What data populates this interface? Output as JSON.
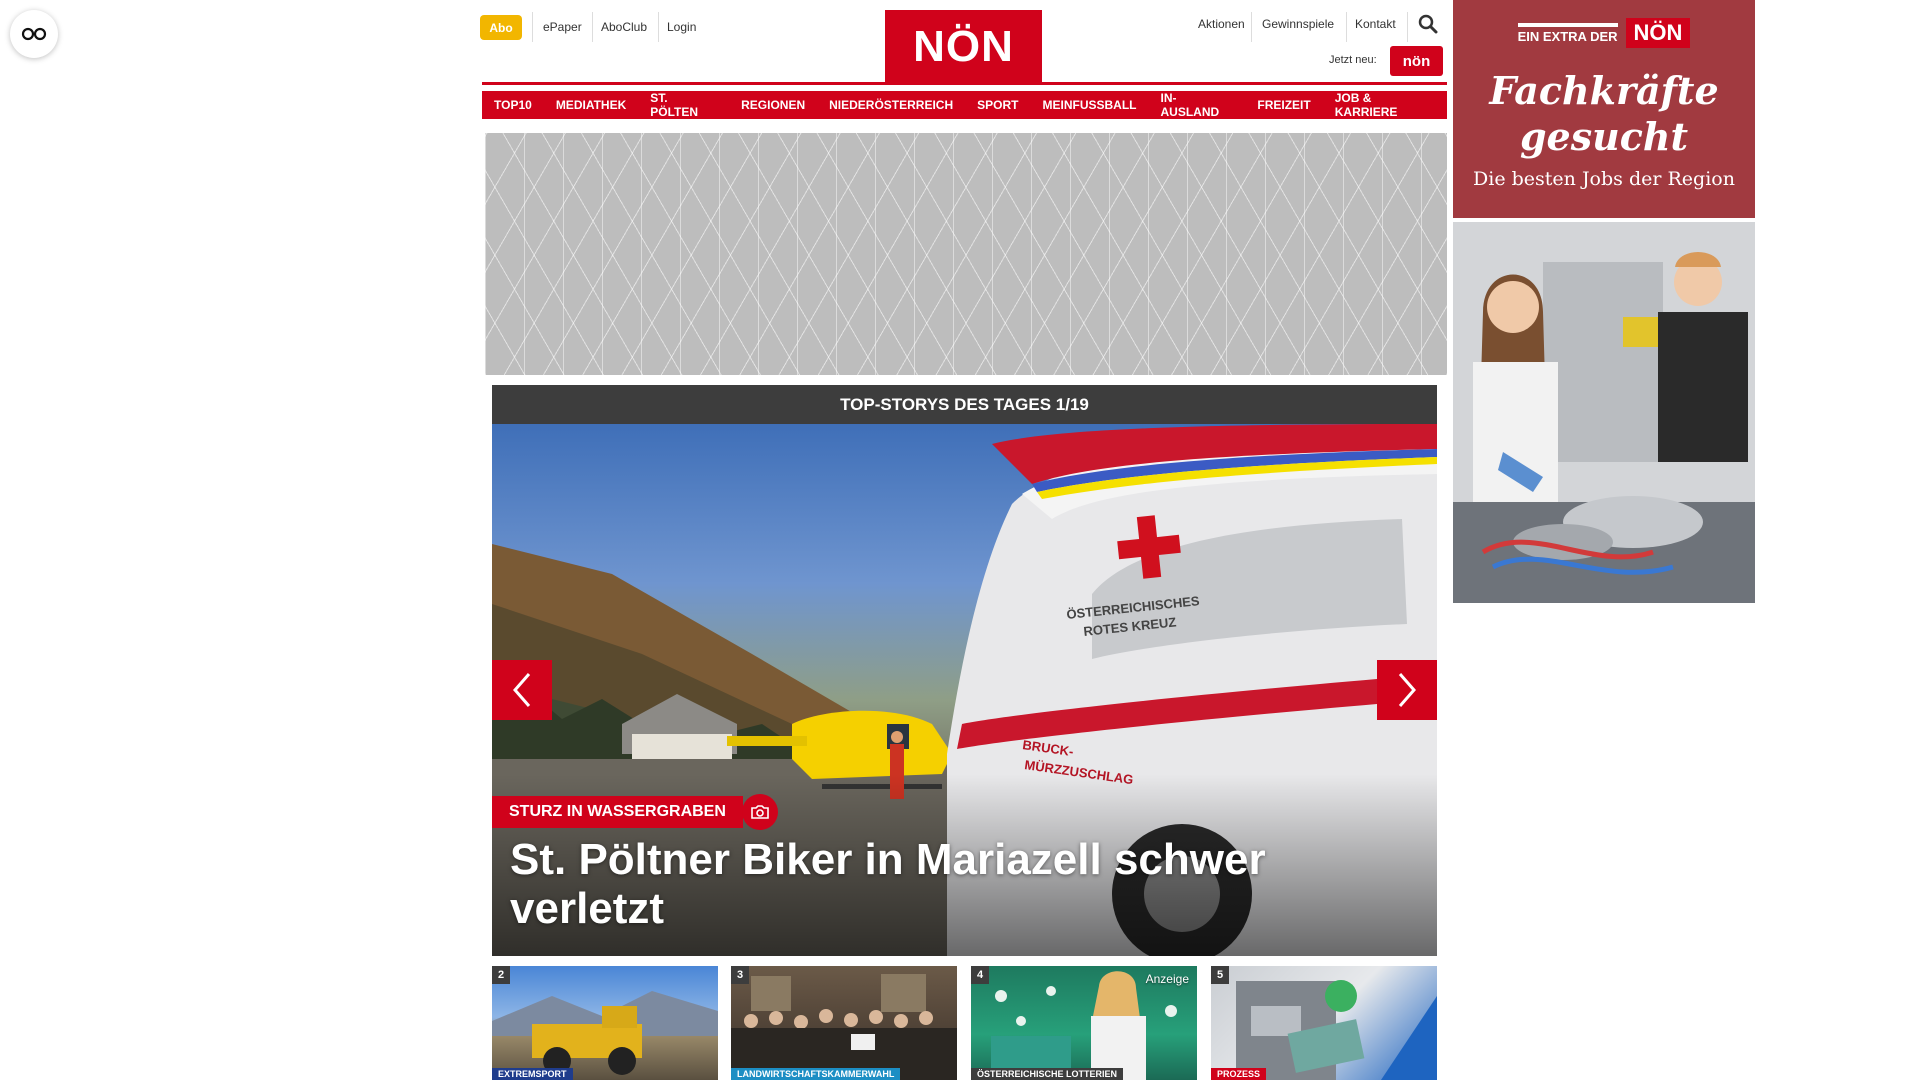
{
  "accessibility": {
    "icon": "glasses-icon"
  },
  "utility_nav": {
    "abo": "Abo",
    "links": [
      "ePaper",
      "AboClub",
      "Login"
    ]
  },
  "top_right_nav": {
    "links": [
      "Aktionen",
      "Gewinnspiele",
      "Kontakt"
    ],
    "search_icon": "search-icon",
    "jetzt_neu": "Jetzt neu:",
    "badge": "nön"
  },
  "logo": {
    "text": "NÖN"
  },
  "main_nav": {
    "items": [
      "TOP10",
      "MEDIATHEK",
      "ST. PÖLTEN",
      "REGIONEN",
      "NIEDERÖSTERREICH",
      "SPORT",
      "MEINFUSSBALL",
      "IN-AUSLAND",
      "FREIZEIT",
      "JOB & KARRIERE"
    ]
  },
  "top_stories": {
    "header": "TOP-STORYS DES TAGES 1/19",
    "hero": {
      "kicker": "STURZ IN WASSERGRABEN",
      "title": "St. Pöltner Biker in Mariazell schwer verletzt",
      "ambulance_text_1": "ÖSTERREICHISCHES",
      "ambulance_text_2": "ROTES KREUZ",
      "ambulance_text_3": "BRUCK-",
      "ambulance_text_4": "MÜRZZUSCHLAG"
    },
    "thumbnails": [
      {
        "number": "2",
        "kicker": "EXTREMSPORT"
      },
      {
        "number": "3",
        "kicker": "LANDWIRTSCHAFTSKAMMERWAHL"
      },
      {
        "number": "4",
        "kicker": "ÖSTERREICHISCHE LOTTERIEN",
        "ad_label": "Anzeige"
      },
      {
        "number": "5",
        "kicker": "PROZESS"
      }
    ]
  },
  "side_ad": {
    "extra": "EIN EXTRA DER",
    "brand": "NÖN",
    "headline_line1": "Fachkräfte",
    "headline_line2": "gesucht",
    "sub": "Die besten Jobs der Region"
  },
  "colors": {
    "brand_red": "#d0021b",
    "abo_yellow": "#f2b600",
    "dark_header": "#3d3d3d",
    "ad_maroon": "#a13a40"
  }
}
